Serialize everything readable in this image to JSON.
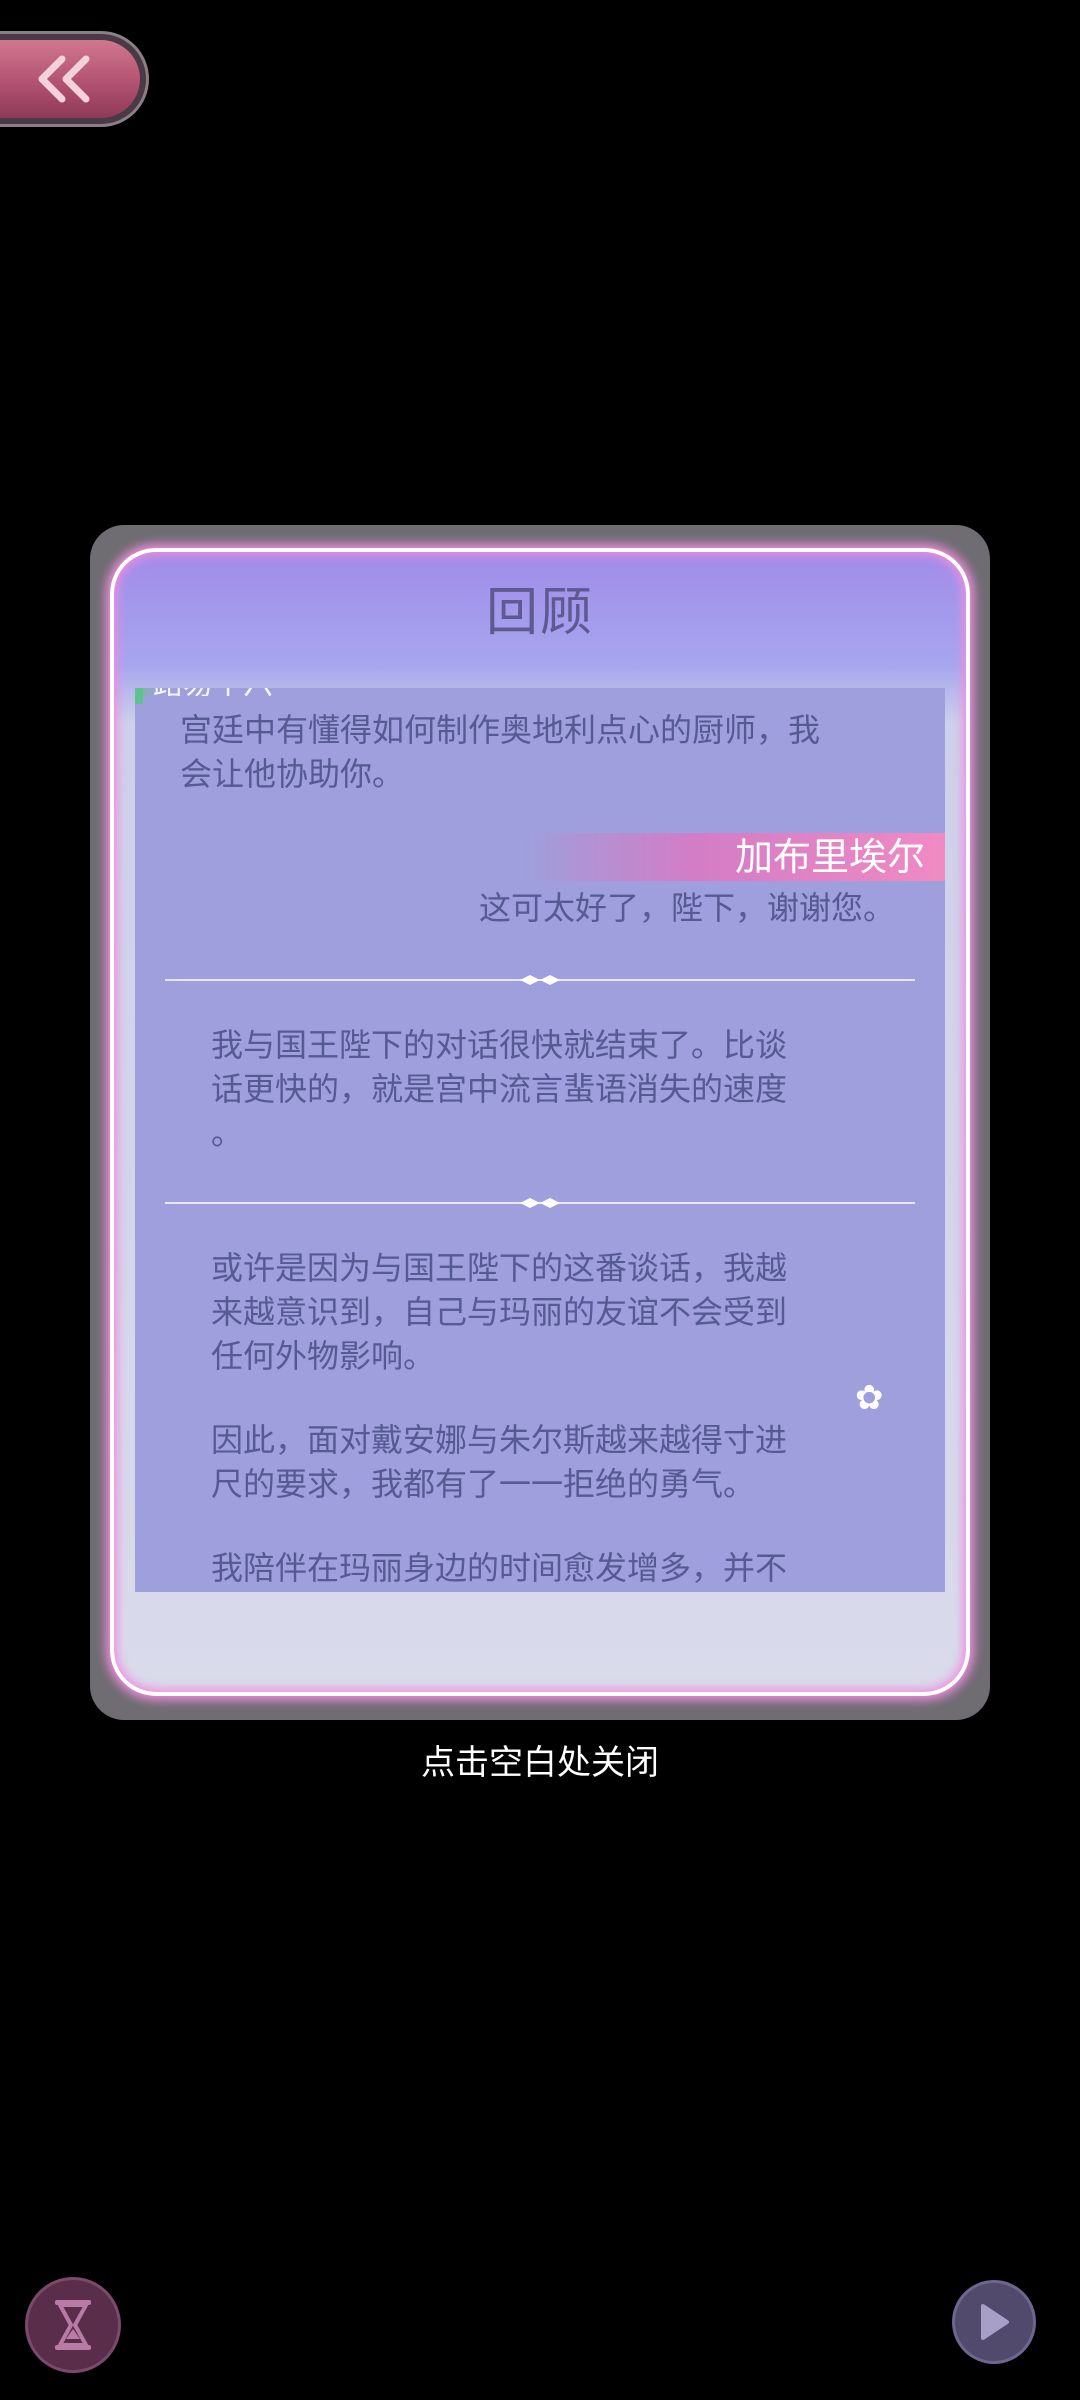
{
  "dialog": {
    "title": "回顾",
    "top_speaker_partial": "路易十六",
    "line1": "宫廷中有懂得如何制作奥地利点心的厨师，我",
    "line2": "会让他协助你。",
    "speaker_right": "加布里埃尔",
    "reply": "这可太好了，陛下，谢谢您。",
    "narration1": [
      "我与国王陛下的对话很快就结束了。比谈",
      "话更快的，就是宫中流言蜚语消失的速度",
      "。"
    ],
    "narration2": [
      "或许是因为与国王陛下的这番谈话，我越",
      "来越意识到，自己与玛丽的友谊不会受到",
      "任何外物影响。"
    ],
    "narration3": [
      "因此，面对戴安娜与朱尔斯越来越得寸进",
      "尺的要求，我都有了一一拒绝的勇气。"
    ],
    "narration4": "我陪伴在玛丽身边的时间愈发增多，并不"
  },
  "close_hint": "点击空白处关闭",
  "colors": {
    "panel": "#9e9fdc",
    "text": "#565a92",
    "speaker_highlight": "#f08ac3",
    "glow": "#f08ddf"
  },
  "icons": {
    "back": "double-chevron-left-icon",
    "hourglass": "hourglass-icon",
    "play": "play-icon",
    "flower": "flower-icon"
  }
}
